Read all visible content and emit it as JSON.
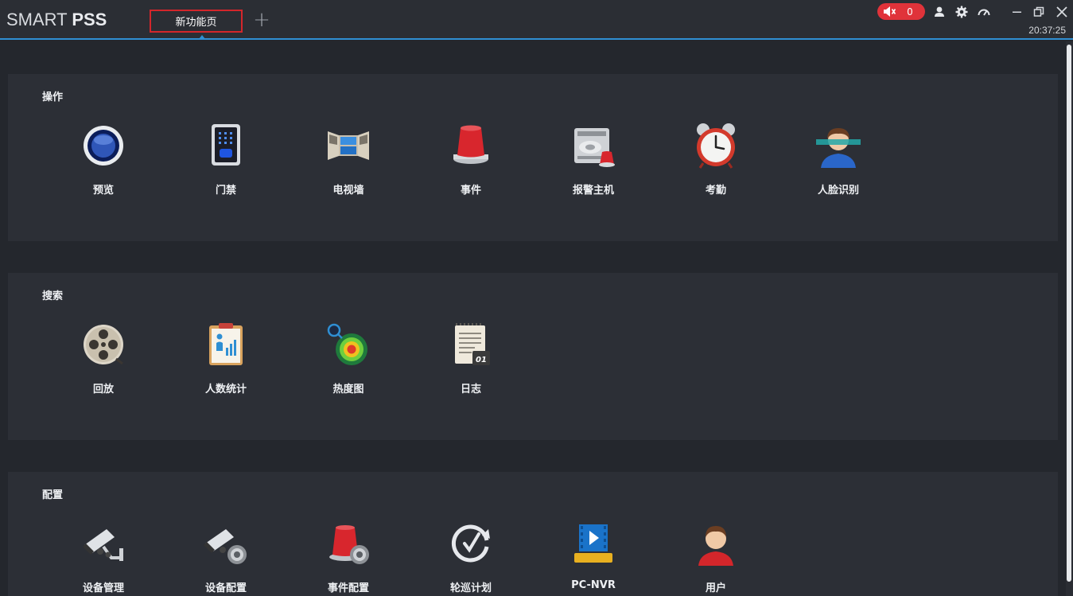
{
  "app": {
    "logo_light": "SMART ",
    "logo_bold": "PSS"
  },
  "tabs": [
    {
      "label": "新功能页",
      "active": true
    }
  ],
  "add_tab_symbol": "+",
  "alarm": {
    "count": "0",
    "badge_color": "#e0333a"
  },
  "window_controls": [
    "user-icon",
    "gear-icon",
    "performance-icon",
    "minimize-icon",
    "restore-icon",
    "close-icon"
  ],
  "clock": "20:37:25",
  "accent_color": "#2f8fd3",
  "sections": [
    {
      "title": "操作",
      "items": [
        {
          "label": "预览",
          "icon": "preview-icon"
        },
        {
          "label": "门禁",
          "icon": "access-control-icon"
        },
        {
          "label": "电视墙",
          "icon": "video-wall-icon"
        },
        {
          "label": "事件",
          "icon": "event-alarm-icon"
        },
        {
          "label": "报警主机",
          "icon": "alarm-host-icon"
        },
        {
          "label": "考勤",
          "icon": "alarm-clock-icon"
        },
        {
          "label": "人脸识别",
          "icon": "face-recognition-icon"
        }
      ]
    },
    {
      "title": "搜索",
      "items": [
        {
          "label": "回放",
          "icon": "film-reel-icon"
        },
        {
          "label": "人数统计",
          "icon": "people-count-icon"
        },
        {
          "label": "热度图",
          "icon": "heatmap-icon"
        },
        {
          "label": "日志",
          "icon": "log-notepad-icon"
        }
      ]
    },
    {
      "title": "配置",
      "items": [
        {
          "label": "设备管理",
          "icon": "camera-manage-icon"
        },
        {
          "label": "设备配置",
          "icon": "camera-config-icon"
        },
        {
          "label": "事件配置",
          "icon": "event-config-icon"
        },
        {
          "label": "轮巡计划",
          "icon": "tour-plan-icon"
        },
        {
          "label": "PC-NVR",
          "icon": "pc-nvr-icon"
        },
        {
          "label": "用户",
          "icon": "user-account-icon"
        }
      ]
    }
  ]
}
